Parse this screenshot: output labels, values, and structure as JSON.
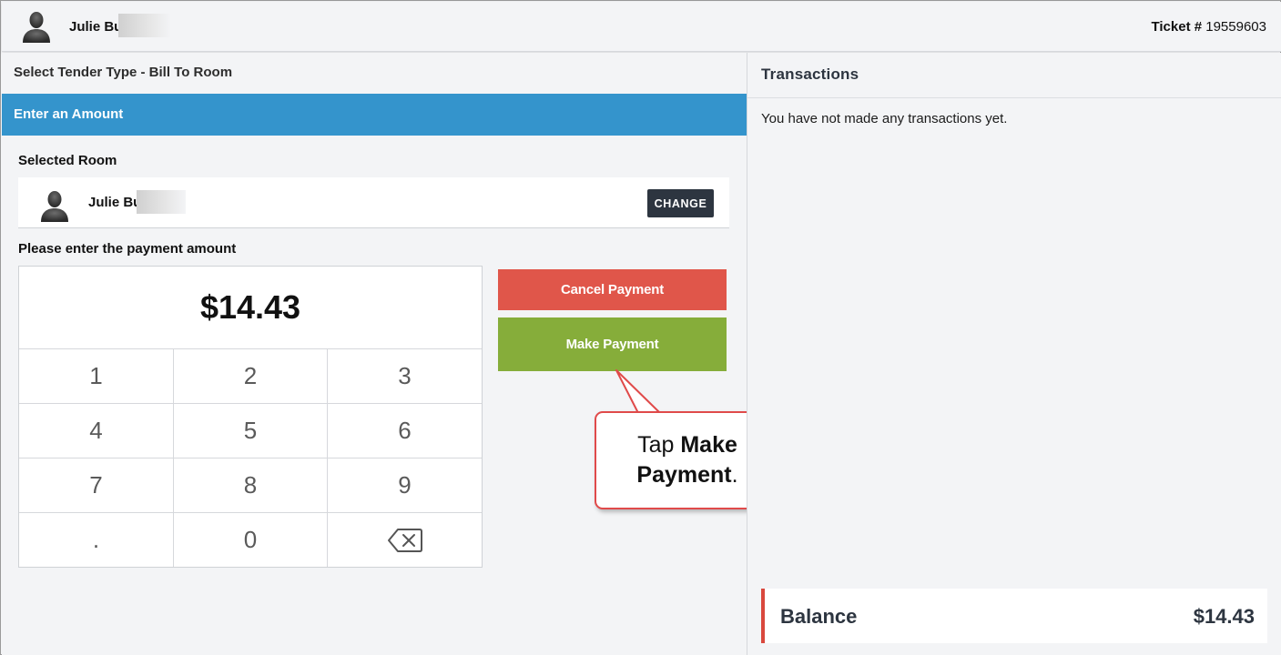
{
  "header": {
    "user_name": "Julie Bu",
    "ticket_label": "Ticket #",
    "ticket_number": "19559603"
  },
  "left": {
    "tender_title": "Select Tender Type - Bill To Room",
    "amount_bar_title": "Enter an Amount",
    "selected_room_label": "Selected Room",
    "room_user_name": "Julie Bu",
    "change_label": "CHANGE",
    "enter_amount_label": "Please enter the payment amount",
    "amount_display": "$14.43",
    "keys": [
      "1",
      "2",
      "3",
      "4",
      "5",
      "6",
      "7",
      "8",
      "9",
      ".",
      "0"
    ],
    "cancel_label": "Cancel Payment",
    "make_label": "Make Payment"
  },
  "callout": {
    "prefix": "Tap ",
    "bold": "Make Payment",
    "suffix": "."
  },
  "right": {
    "title": "Transactions",
    "empty_message": "You have not made any transactions yet.",
    "balance_label": "Balance",
    "balance_value": "$14.43"
  },
  "colors": {
    "blue_bar": "#3494cc",
    "cancel": "#e0564a",
    "make": "#86ad3a",
    "change_button": "#2d3540",
    "balance_accent": "#d9483d",
    "callout_border": "#e04a4a"
  },
  "icons": {
    "avatar": "user-silhouette-icon",
    "backspace": "backspace-icon"
  }
}
